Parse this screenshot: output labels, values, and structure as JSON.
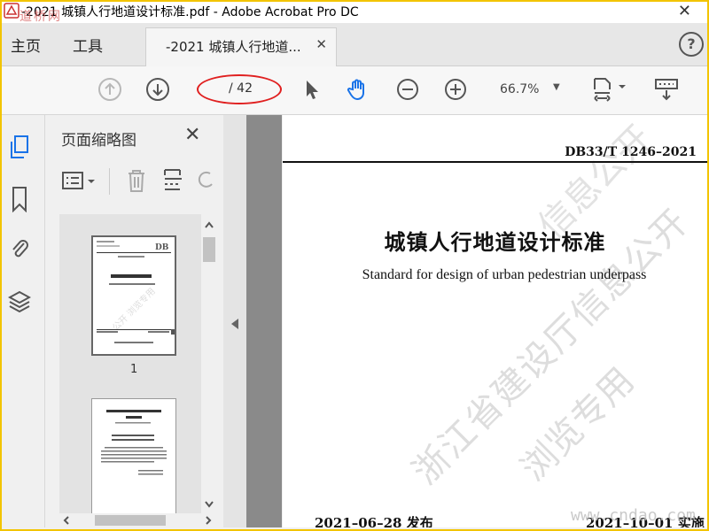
{
  "window": {
    "title": "-2021 城镇人行地道设计标准.pdf - Adobe Acrobat Pro DC",
    "corner_watermark": "道桥网"
  },
  "menubar": {
    "home_label": "主页",
    "tools_label": "工具",
    "doc_tab_label": "-2021 城镇人行地道...",
    "help_label": "?"
  },
  "toolbar": {
    "page_current": "",
    "page_total": "/ 42",
    "zoom": "66.7%"
  },
  "thumbnail_panel": {
    "title": "页面缩略图",
    "thumbs": [
      {
        "label": "1"
      }
    ]
  },
  "document": {
    "standard_code": "DB33/T 1246–2021",
    "title_cn": "城镇人行地道设计标准",
    "title_en": "Standard for design of urban pedestrian underpass",
    "issue_date": "2021–06–28  发布",
    "effective_date": "2021–10–01  实施",
    "watermark_main": "浙江省建设厅信息公开",
    "watermark_secondary": "浏览专用",
    "watermark_top": "信息公开",
    "site_watermark": "www.cndao.com"
  },
  "colors": {
    "annotation_oval": "#e02020",
    "frame_border": "#f2c400",
    "gutter": "#8a8a8a"
  },
  "icons": [
    "acrobat-icon",
    "close-icon",
    "help-icon",
    "prev-page-icon",
    "next-page-icon",
    "select-arrow-icon",
    "hand-icon",
    "zoom-out-icon",
    "zoom-in-icon",
    "fit-page-icon",
    "scroll-mode-icon",
    "thumbnails-icon",
    "bookmark-icon",
    "attachment-icon",
    "layers-icon",
    "panel-options-icon",
    "delete-icon",
    "insert-page-icon",
    "rotate-icon"
  ]
}
